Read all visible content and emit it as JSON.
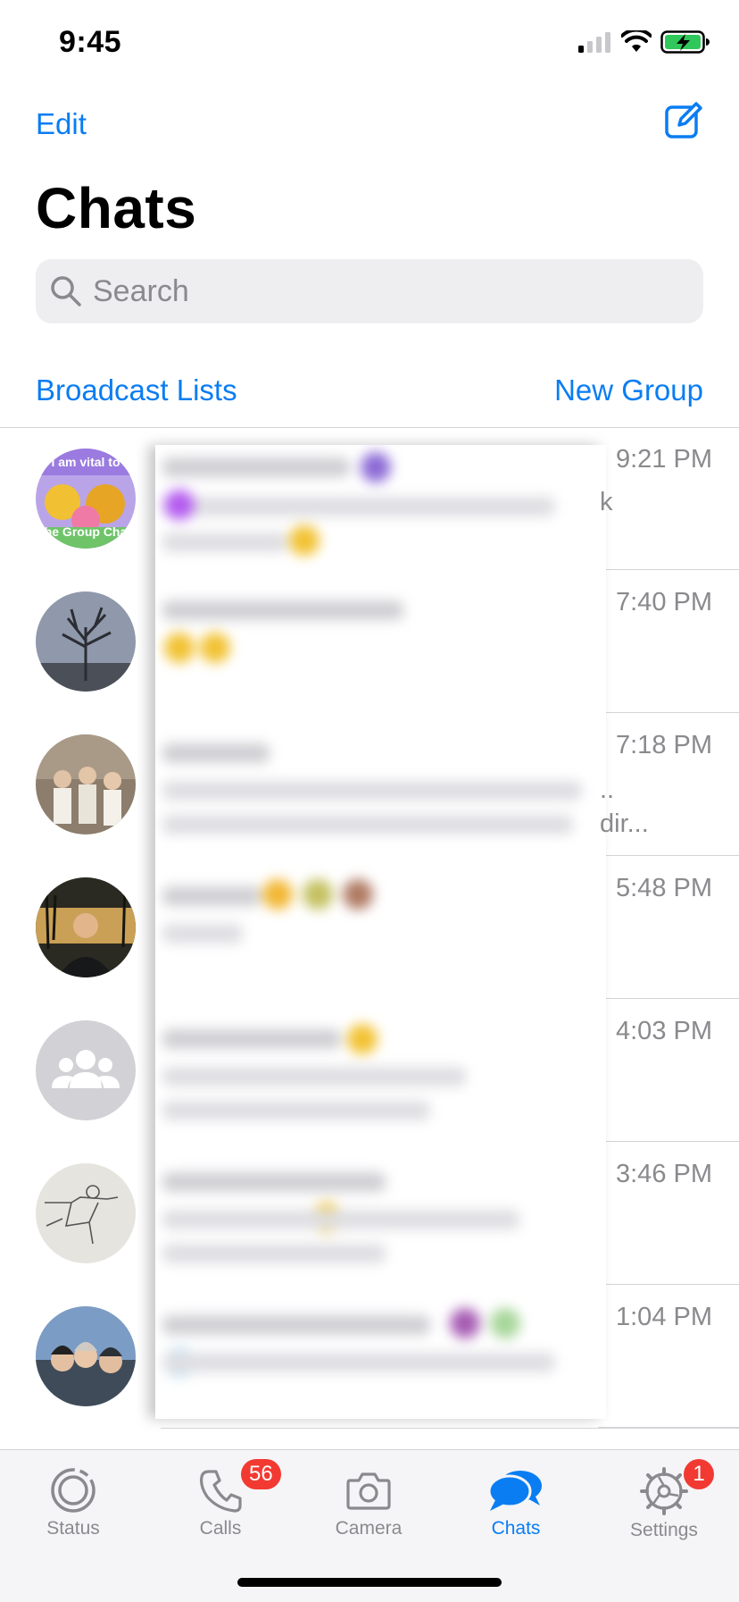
{
  "status_bar": {
    "time": "9:45"
  },
  "header": {
    "edit_label": "Edit",
    "title": "Chats"
  },
  "search": {
    "placeholder": "Search"
  },
  "links": {
    "broadcast": "Broadcast Lists",
    "new_group": "New Group"
  },
  "chats": [
    {
      "time": "9:21 PM",
      "avatar_text_top": "I am vital to",
      "avatar_text_bottom": "the Group Chat"
    },
    {
      "time": "7:40 PM"
    },
    {
      "time": "7:18 PM"
    },
    {
      "time": "5:48 PM"
    },
    {
      "time": "4:03 PM"
    },
    {
      "time": "3:46 PM"
    },
    {
      "time": "1:04 PM"
    }
  ],
  "visible_peek": {
    "row1": "k",
    "row3a": "..",
    "row3b": "dir..."
  },
  "tabs": [
    {
      "label": "Status",
      "icon": "status-ring-icon"
    },
    {
      "label": "Calls",
      "icon": "phone-icon",
      "badge": "56"
    },
    {
      "label": "Camera",
      "icon": "camera-icon"
    },
    {
      "label": "Chats",
      "icon": "chat-bubbles-icon",
      "active": true
    },
    {
      "label": "Settings",
      "icon": "gear-icon",
      "badge": "1"
    }
  ],
  "colors": {
    "accent": "#0a7df2",
    "badge": "#f23a32",
    "battery": "#30c85a"
  }
}
